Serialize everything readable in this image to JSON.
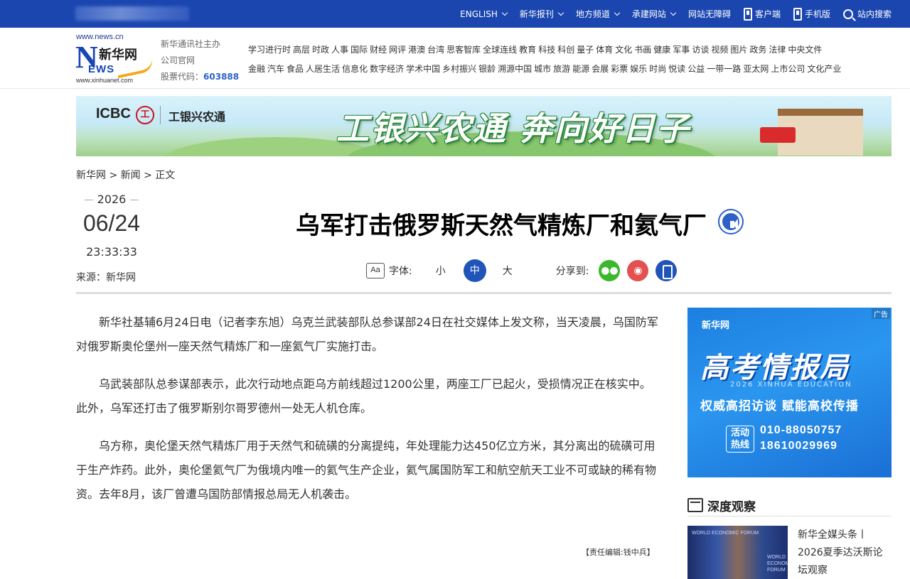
{
  "topnav": {
    "items": [
      {
        "label": "ENGLISH",
        "dropdown": true
      },
      {
        "label": "新华报刊",
        "dropdown": true
      },
      {
        "label": "地方频道",
        "dropdown": true
      },
      {
        "label": "承建网站",
        "dropdown": true
      },
      {
        "label": "网站无障碍",
        "dropdown": false
      },
      {
        "label": "客户端",
        "icon": "phone-icon"
      },
      {
        "label": "手机版",
        "icon": "mobile-icon"
      },
      {
        "label": "站内搜索",
        "icon": "search-icon"
      }
    ]
  },
  "header": {
    "logo": {
      "url_top": "www.news.cn",
      "cn": "新华网",
      "ews": "EWS",
      "n": "N",
      "url_bottom": "www.xinhuanet.com"
    },
    "org_line1": "新华通讯社主办",
    "org_line2": "公司官网",
    "stock_label": "股票代码：",
    "stock_code": "603888",
    "channels_row1": [
      "学习进行时",
      "高层",
      "时政",
      "人事",
      "国际",
      "财经",
      "网评",
      "港澳",
      "台湾",
      "思客智库",
      "全球连线",
      "教育",
      "科技",
      "科创",
      "量子",
      "体育",
      "文化",
      "书画",
      "健康",
      "军事",
      "访谈",
      "视频",
      "图片",
      "政务",
      "法律",
      "中央文件"
    ],
    "channels_row2": [
      "金融",
      "汽车",
      "食品",
      "人居生活",
      "信息化",
      "数字经济",
      "学术中国",
      "乡村振兴",
      "银龄",
      "溯源中国",
      "城市",
      "旅游",
      "能源",
      "会展",
      "彩票",
      "娱乐",
      "时尚",
      "悦读",
      "公益",
      "一带一路",
      "亚太网",
      "上市公司",
      "文化产业"
    ]
  },
  "banner": {
    "icbc": "ICBC",
    "icbc_mark": "工",
    "brand": "工银兴农通",
    "slogan": "工银兴农通 奔向好日子"
  },
  "breadcrumb": {
    "home": "新华网",
    "section": "新闻",
    "current": "正文",
    "sep": ">"
  },
  "meta": {
    "year": "2026",
    "month_day": "06/24",
    "time": "23:33:33",
    "source": "来源：新华网"
  },
  "article": {
    "title": "乌军打击俄罗斯天然气精炼厂和氦气厂",
    "font_label": "字体:",
    "font_small": "小",
    "font_medium": "中",
    "font_large": "大",
    "share_label": "分享到:",
    "paragraphs": [
      "新华社基辅6月24日电（记者李东旭）乌克兰武装部队总参谋部24日在社交媒体上发文称，当天凌晨，乌国防军对俄罗斯奥伦堡州一座天然气精炼厂和一座氦气厂实施打击。",
      "乌武装部队总参谋部表示，此次行动地点距乌方前线超过1200公里，两座工厂已起火，受损情况正在核实中。此外，乌军还打击了俄罗斯别尔哥罗德州一处无人机仓库。",
      "乌方称，奥伦堡天然气精炼厂用于天然气和硫磺的分离提纯，年处理能力达450亿立方米，其分离出的硫磺可用于生产炸药。此外，奥伦堡氦气厂为俄境内唯一的氦气生产企业，氦气属国防军工和航空航天工业不可或缺的稀有物资。去年8月，该厂曾遭乌国防部情报总局无人机袭击。"
    ],
    "editor": "【责任编辑:钱中兵】"
  },
  "ad": {
    "tag": "广告",
    "mini_logo": "新华网",
    "headline": "高考情报局",
    "sub": "2026 XINHUA EDUCATION",
    "sub2": "权威高招访谈 赋能高校传播",
    "hotline_label": "活动热线",
    "phone1": "010-88050757",
    "phone2": "18610029969"
  },
  "depth": {
    "title": "深度观察",
    "item_text": "新华全媒头条丨2026夏季达沃斯论坛观察",
    "img_text": "WORLD ECONOMIC FORUM"
  }
}
